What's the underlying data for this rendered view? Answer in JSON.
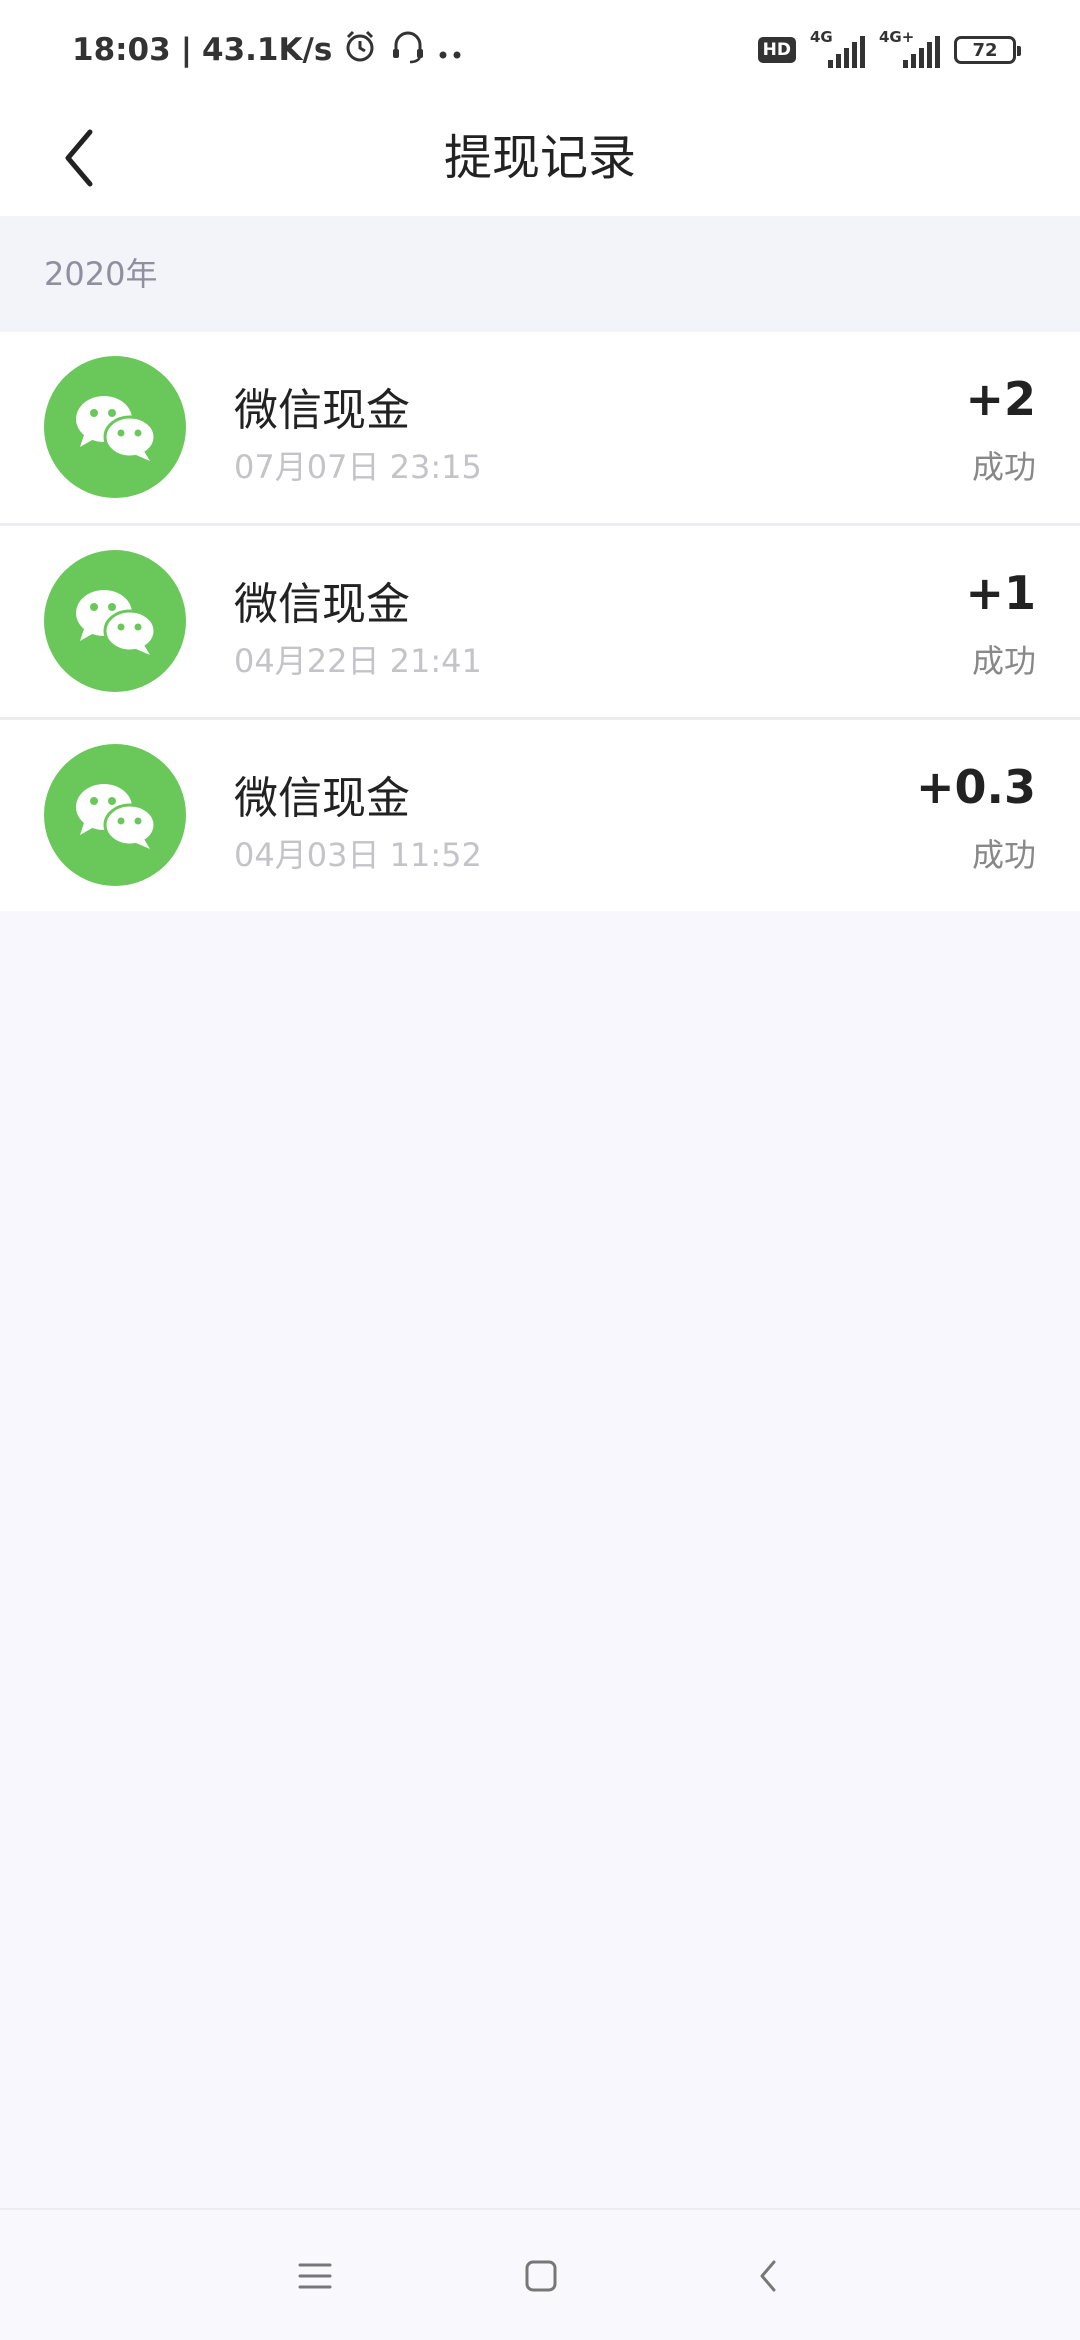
{
  "status_bar": {
    "time": "18:03",
    "speed": "43.1K/s",
    "hd": "HD",
    "net1": "4G",
    "net2": "4G+",
    "battery": "72"
  },
  "header": {
    "title": "提现记录"
  },
  "section": {
    "year": "2020年"
  },
  "records": [
    {
      "title": "微信现金",
      "time": "07月07日 23:15",
      "amount": "+2",
      "status": "成功"
    },
    {
      "title": "微信现金",
      "time": "04月22日 21:41",
      "amount": "+1",
      "status": "成功"
    },
    {
      "title": "微信现金",
      "time": "04月03日 11:52",
      "amount": "+0.3",
      "status": "成功"
    }
  ],
  "colors": {
    "wechat_green": "#6ac85a",
    "page_bg": "#f7f7fd"
  }
}
